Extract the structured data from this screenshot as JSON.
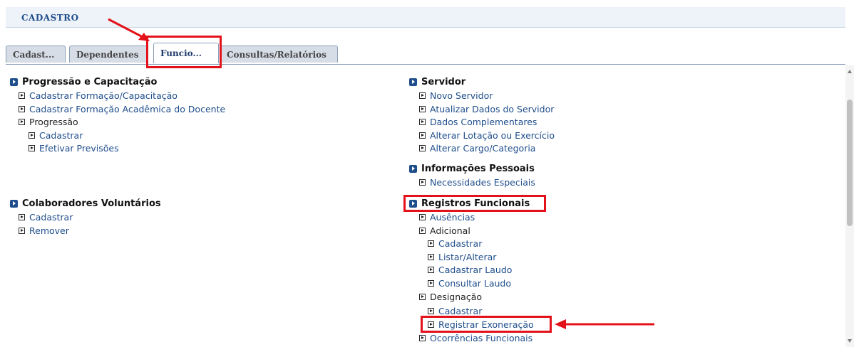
{
  "header": {
    "title": "CADASTRO"
  },
  "tabs": [
    {
      "label": "Cadast..."
    },
    {
      "label": "Dependentes"
    },
    {
      "label": "Funcio..."
    },
    {
      "label": "Consultas/Relatórios"
    }
  ],
  "left": {
    "progressao": {
      "title": "Progressão e Capacitação",
      "items": [
        "Cadastrar Formação/Capacitação",
        "Cadastrar Formação Acadêmica do Docente"
      ],
      "group": "Progressão",
      "subitems": [
        "Cadastrar",
        "Efetivar Previsões"
      ]
    },
    "colaboradores": {
      "title": "Colaboradores Voluntários",
      "items": [
        "Cadastrar",
        "Remover"
      ]
    }
  },
  "right": {
    "servidor": {
      "title": "Servidor",
      "items": [
        "Novo Servidor",
        "Atualizar Dados do Servidor",
        "Dados Complementares",
        "Alterar Lotação ou Exercício",
        "Alterar Cargo/Categoria"
      ]
    },
    "pessoais": {
      "title": "Informações Pessoais",
      "items": [
        "Necessidades Especiais"
      ]
    },
    "registros": {
      "title": "Registros Funcionais",
      "ausencias": "Ausências",
      "adicional": "Adicional",
      "adicional_items": [
        "Cadastrar",
        "Listar/Alterar",
        "Cadastrar Laudo",
        "Consultar Laudo"
      ],
      "designacao": "Designação",
      "designacao_items": [
        "Cadastrar",
        "Registrar Exoneração"
      ],
      "ocorrencias": "Ocorrências Funcionais"
    }
  },
  "colors": {
    "accent": "#1f4e8c",
    "highlight": "#e3121a"
  }
}
